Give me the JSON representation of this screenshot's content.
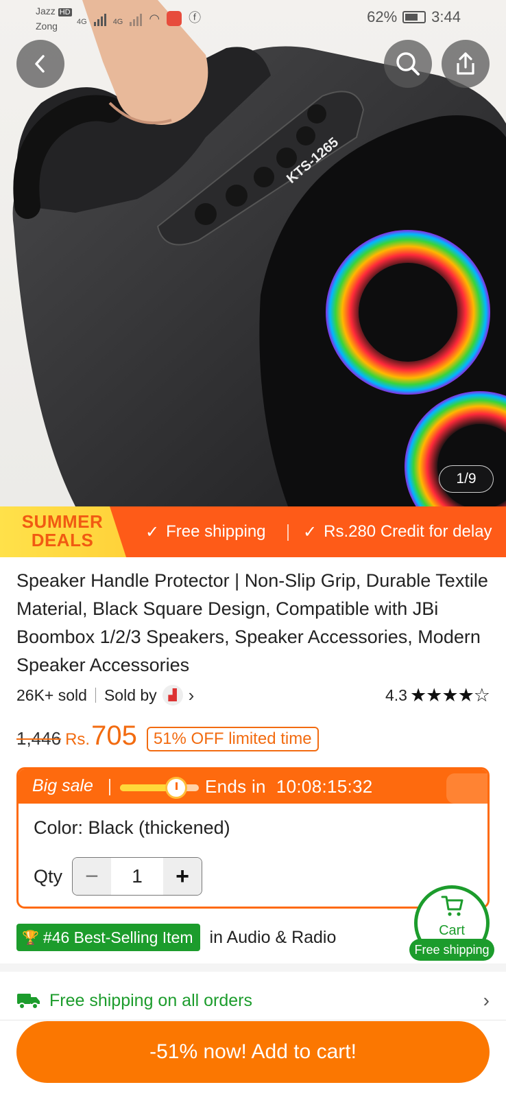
{
  "status_bar": {
    "carrier_1": "Jazz",
    "carrier_2": "Zong",
    "hd_badge": "HD",
    "net_1": "4G",
    "net_2": "4G",
    "battery": "62%",
    "time": "3:44"
  },
  "gallery": {
    "counter": "1/9",
    "model_text": "KTS-1265"
  },
  "promo": {
    "deal_label": "SUMMER DEALS",
    "feature_1": "Free shipping",
    "feature_2": "Rs.280 Credit for delay"
  },
  "product": {
    "title": "Speaker Handle Protector | Non-Slip Grip, Durable Textile Material, Black Square Design, Compatible with JBi Boombox 1/2/3 Speakers, Speaker Accessories, Modern Speaker Accessories",
    "sold": "26K+ sold",
    "sold_by": "Sold by",
    "rating": "4.3",
    "stars": "★★★★☆"
  },
  "price": {
    "old": "1,446",
    "currency": "Rs.",
    "current": "705",
    "discount": "51% OFF limited time"
  },
  "sale": {
    "label": "Big sale",
    "progress": 0.7,
    "ends_label": "Ends in",
    "countdown": "10:08:15:32",
    "color": "Color: Black (thickened)",
    "qty_label": "Qty",
    "qty_value": "1",
    "minus": "−",
    "plus": "+"
  },
  "best_seller": {
    "badge": "#46 Best-Selling Item",
    "category": "in Audio & Radio"
  },
  "cart_bubble": {
    "label": "Cart",
    "pill": "Free shipping"
  },
  "shipping": {
    "text": "Free shipping on all orders"
  },
  "cta": {
    "add_to_cart": "-51% now! Add to cart!"
  },
  "colors": {
    "accent_orange": "#fe5b18",
    "price_orange": "#f26b10",
    "green": "#1c9c2c",
    "cta": "#fb7701"
  }
}
